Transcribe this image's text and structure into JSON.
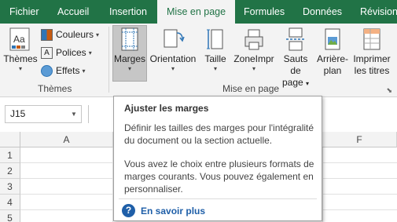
{
  "tabs": [
    {
      "label": "Fichier"
    },
    {
      "label": "Accueil"
    },
    {
      "label": "Insertion"
    },
    {
      "label": "Mise en page",
      "active": true
    },
    {
      "label": "Formules"
    },
    {
      "label": "Données"
    },
    {
      "label": "Révision"
    }
  ],
  "ribbon": {
    "themes_group": {
      "themes_button": "Thèmes",
      "colors": "Couleurs",
      "fonts": "Polices",
      "effects": "Effets",
      "label": "Thèmes"
    },
    "page_setup_group": {
      "margins": "Marges",
      "orientation": "Orientation",
      "size": "Taille",
      "print_area_line1": "ZoneImpr",
      "breaks_line1": "Sauts de",
      "breaks_line2": "page",
      "background_line1": "Arrière-",
      "background_line2": "plan",
      "print_titles_line1": "Imprimer",
      "print_titles_line2": "les titres",
      "label": "Mise en page"
    }
  },
  "namebox": {
    "value": "J15"
  },
  "grid": {
    "columns": [
      "A",
      "F"
    ],
    "rows": [
      "1",
      "2",
      "3",
      "4",
      "5"
    ]
  },
  "tooltip": {
    "title": "Ajuster les marges",
    "para1_line1": "Définir les tailles des marges pour l'intégralité",
    "para1_line2": "du document ou la section actuelle.",
    "para2_line1": "Vous avez le choix entre plusieurs formats de",
    "para2_line2": "marges courants. Vous pouvez également en",
    "para2_line3": "personnaliser.",
    "help_link": "En savoir plus"
  },
  "colors": {
    "brand": "#217346",
    "link": "#1f5fa8"
  }
}
